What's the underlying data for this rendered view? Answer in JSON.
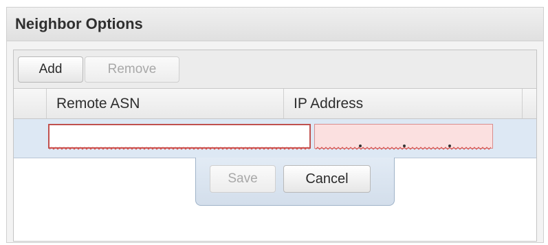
{
  "panel": {
    "title": "Neighbor Options"
  },
  "toolbar": {
    "add_label": "Add",
    "remove_label": "Remove"
  },
  "grid": {
    "columns": [
      "",
      "Remote ASN",
      "IP Address"
    ],
    "edit_row": {
      "remote_asn_value": "",
      "ip_address_value": "",
      "remote_asn_invalid": true,
      "ip_address_invalid": true
    }
  },
  "editor": {
    "save_label": "Save",
    "cancel_label": "Cancel",
    "save_disabled": true
  },
  "colors": {
    "invalid_border": "#c0504d",
    "invalid_fill": "#fbe0e0",
    "editing_row": "#dde8f4"
  }
}
